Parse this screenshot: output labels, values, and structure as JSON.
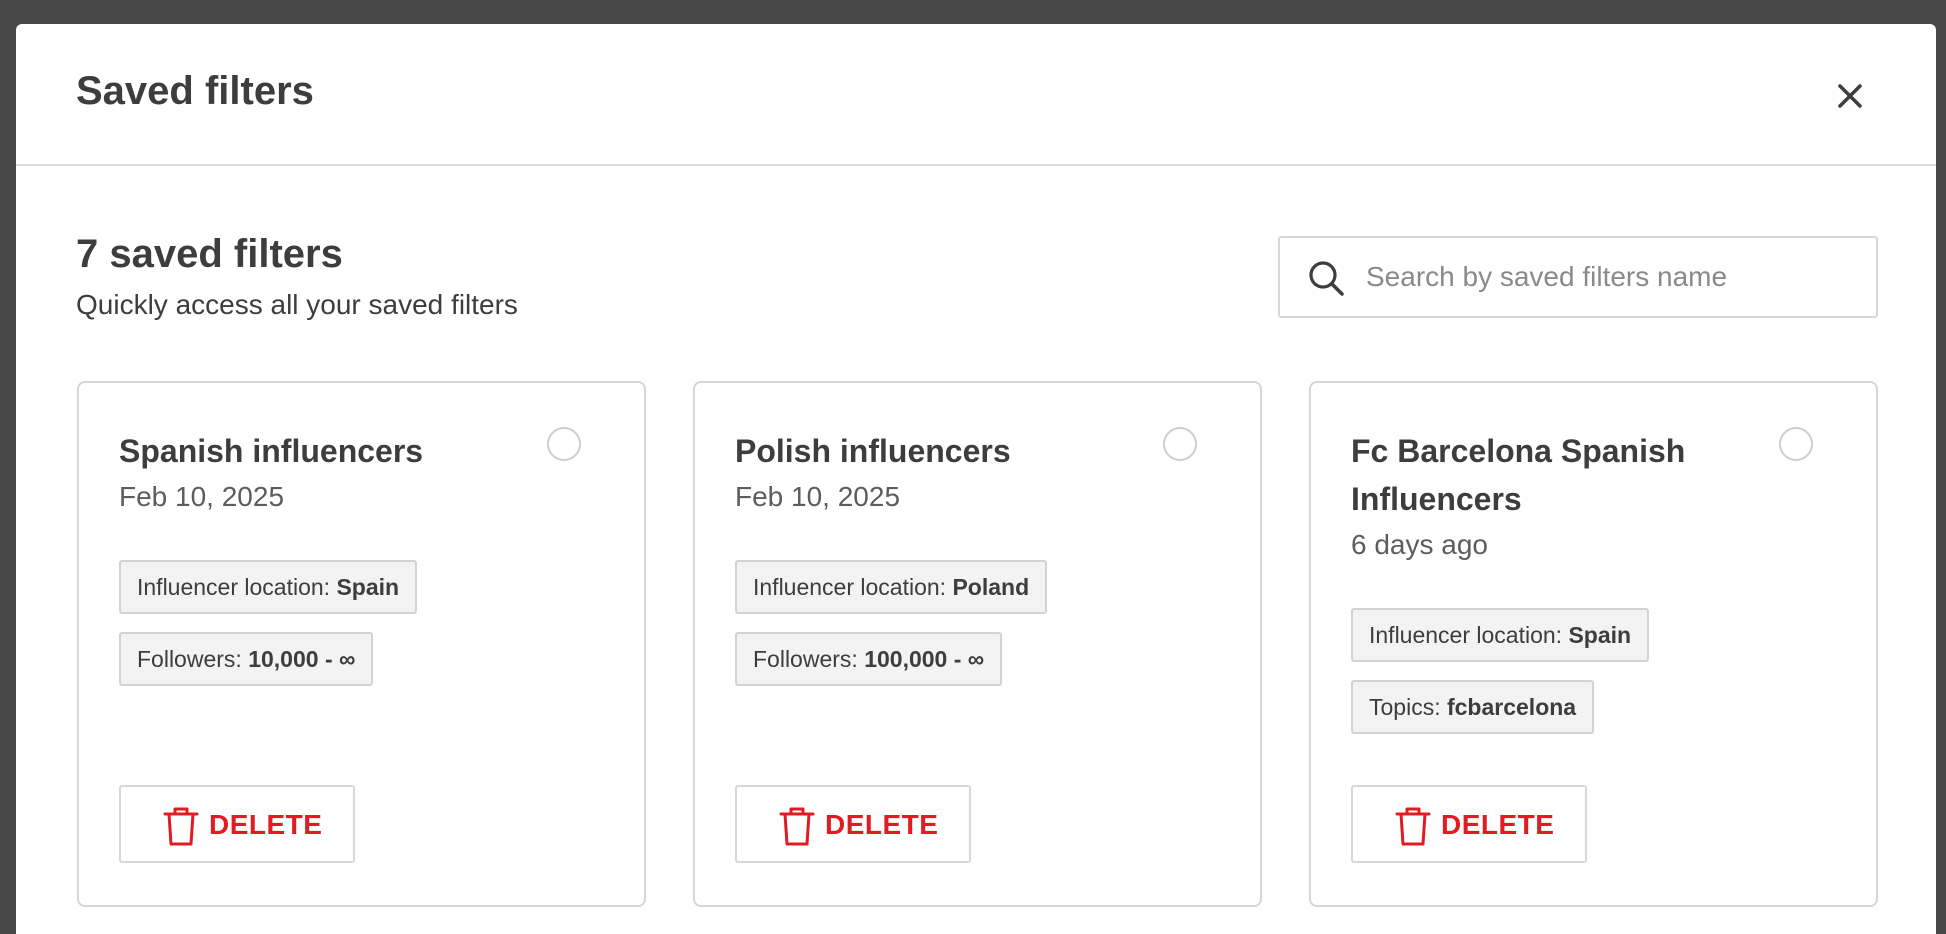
{
  "modal": {
    "title": "Saved filters"
  },
  "summary": {
    "count_label": "7 saved filters",
    "subtitle": "Quickly access all your saved filters"
  },
  "search": {
    "placeholder": "Search by saved filters name",
    "value": ""
  },
  "cards": [
    {
      "title": "Spanish influencers",
      "date": "Feb 10, 2025",
      "tags": [
        {
          "label": "Influencer location:",
          "value": "Spain"
        },
        {
          "label": "Followers:",
          "value": "10,000 - ∞"
        }
      ],
      "delete_label": "DELETE"
    },
    {
      "title": "Polish influencers",
      "date": "Feb 10, 2025",
      "tags": [
        {
          "label": "Influencer location:",
          "value": "Poland"
        },
        {
          "label": "Followers:",
          "value": "100,000 - ∞"
        }
      ],
      "delete_label": "DELETE"
    },
    {
      "title": "Fc Barcelona Spanish Influencers",
      "date": "6 days ago",
      "tags": [
        {
          "label": "Influencer location:",
          "value": "Spain"
        },
        {
          "label": "Topics:",
          "value": "fcbarcelona"
        }
      ],
      "delete_label": "DELETE"
    }
  ],
  "colors": {
    "accent_delete": "#e21b23",
    "text_primary": "#3d3d3d",
    "backdrop": "#474747"
  },
  "icons": {
    "close": "close-icon",
    "search": "search-icon",
    "trash": "trash-icon"
  }
}
